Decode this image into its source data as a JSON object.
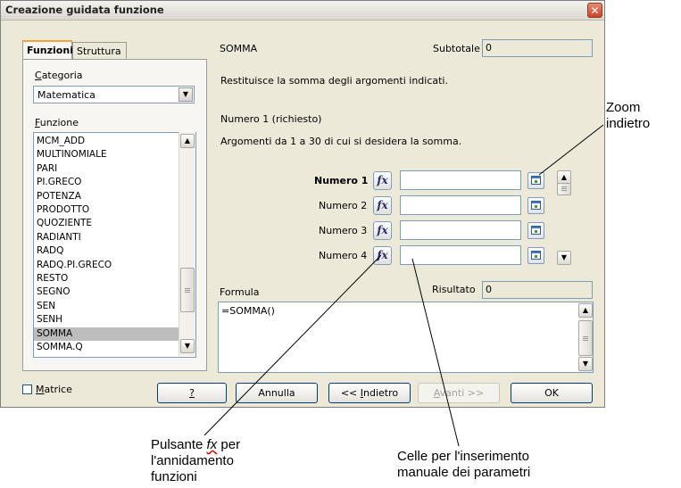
{
  "window": {
    "title": "Creazione guidata funzione",
    "close_label": "✕"
  },
  "tabs": [
    {
      "label": "Funzioni"
    },
    {
      "label": "Struttura"
    }
  ],
  "category": {
    "label": "Categoria",
    "value": "Matematica"
  },
  "function_list": {
    "label": "Funzione",
    "items": [
      "MCM_ADD",
      "MULTINOMIALE",
      "PARI",
      "PI.GRECO",
      "POTENZA",
      "PRODOTTO",
      "QUOZIENTE",
      "RADIANTI",
      "RADQ",
      "RADQ.PI.GRECO",
      "RESTO",
      "SEGNO",
      "SEN",
      "SENH",
      "SOMMA",
      "SOMMA.Q"
    ],
    "selected": "SOMMA"
  },
  "function_info": {
    "name": "SOMMA",
    "subtotal_label": "Subtotale",
    "subtotal_value": "0",
    "description": "Restituisce la somma degli argomenti indicati.",
    "arg_title": "Numero 1 (richiesto)",
    "arg_description": "Argomenti da 1 a 30 di cui si desidera la somma."
  },
  "arguments": [
    {
      "label": "Numero 1",
      "value": ""
    },
    {
      "label": "Numero 2",
      "value": ""
    },
    {
      "label": "Numero 3",
      "value": ""
    },
    {
      "label": "Numero 4",
      "value": ""
    }
  ],
  "fx_label": "fx",
  "formula": {
    "label": "Formula",
    "value": "=SOMMA()",
    "result_label": "Risultato",
    "result_value": "0"
  },
  "matrix": {
    "label": "Matrice",
    "checked": false
  },
  "buttons": {
    "help": "?",
    "cancel": "Annulla",
    "back": "<< Indietro",
    "next": "Avanti >>",
    "ok": "OK"
  },
  "annotations": {
    "zoom_line1": "Zoom",
    "zoom_line2": "indietro",
    "fx_line1": "Pulsante",
    "fx_word": "fx",
    "fx_line1_end": "per",
    "fx_line2": "l'annidamento",
    "fx_line3": "funzioni",
    "cells_line1": "Celle per l'inserimento",
    "cells_line2": "manuale dei parametri"
  }
}
